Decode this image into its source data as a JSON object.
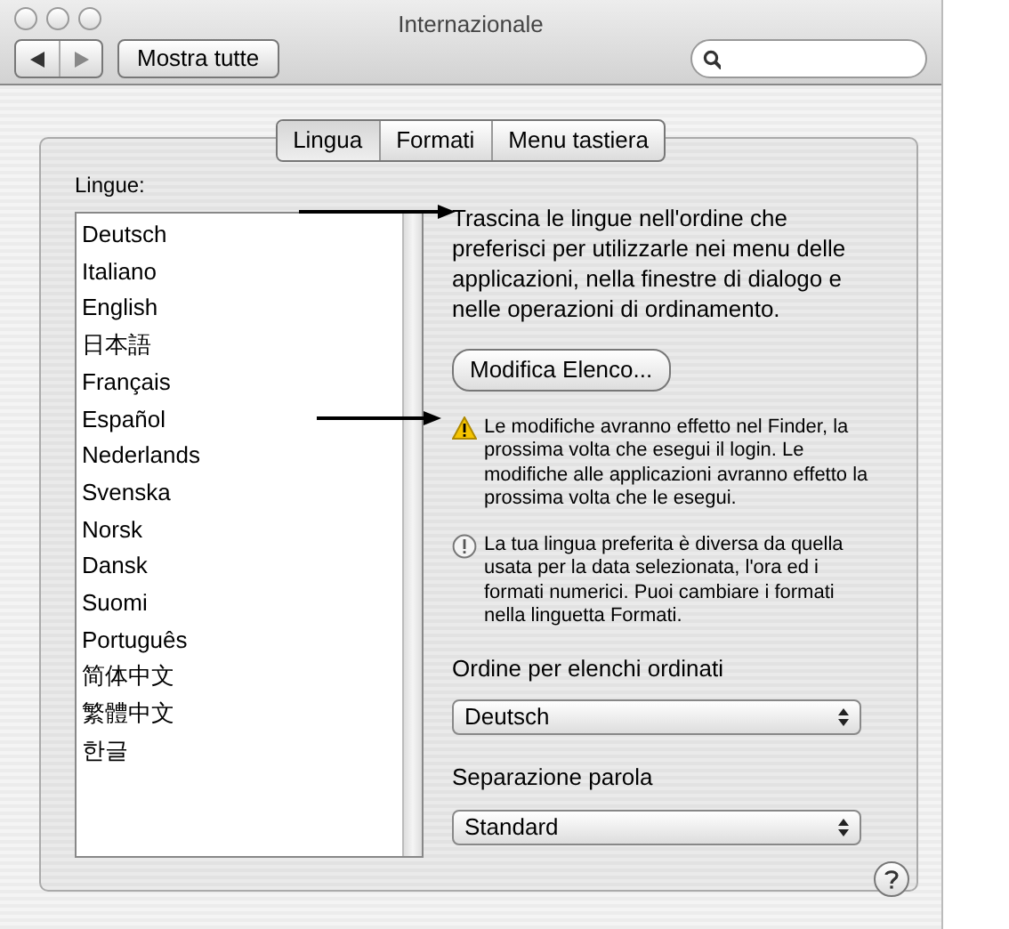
{
  "window": {
    "title": "Internazionale"
  },
  "toolbar": {
    "show_all": "Mostra tutte"
  },
  "tabs": [
    {
      "label": "Lingua",
      "selected": true
    },
    {
      "label": "Formati",
      "selected": false
    },
    {
      "label": "Menu tastiera",
      "selected": false
    }
  ],
  "languages": {
    "label": "Lingue:",
    "items": [
      "Deutsch",
      "Italiano",
      "English",
      "日本語",
      "Français",
      "Español",
      "Nederlands",
      "Svenska",
      "Norsk",
      "Dansk",
      "Suomi",
      "Português",
      "简体中文",
      "繁體中文",
      "한글"
    ]
  },
  "intro": "Trascina le lingue nell'ordine che preferisci per utilizzarle nei menu delle applicazioni, nella finestre di dialogo e nelle operazioni di ordinamento.",
  "edit_button": "Modifica Elenco...",
  "notes": [
    {
      "kind": "warning",
      "text": "Le modifiche avranno effetto nel Finder, la prossima volta che esegui il login. Le modifiche alle applicazioni avranno effetto la prossima volta che le esegui."
    },
    {
      "kind": "info",
      "text": "La tua lingua preferita è diversa da quella usata per la data selezionata, l'ora ed i formati numerici. Puoi cambiare i formati nella linguetta Formati."
    }
  ],
  "sort_order": {
    "label": "Ordine per elenchi ordinati",
    "value": "Deutsch"
  },
  "word_break": {
    "label": "Separazione parola",
    "value": "Standard"
  }
}
